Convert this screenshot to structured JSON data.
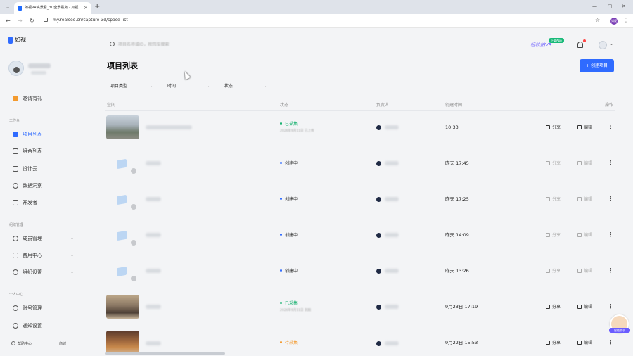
{
  "browser": {
    "tab_title": "如视VR实景看_3D全景看房 - 如视",
    "url": "my.realsee.cn/capture-3d/space-list",
    "profile_initials": "如视"
  },
  "sidebar": {
    "logo": "如视",
    "invite": "邀请有礼",
    "workbench_title": "工作台",
    "items": [
      {
        "label": "项目列表"
      },
      {
        "label": "组合列表"
      },
      {
        "label": "设计云"
      },
      {
        "label": "数据洞察"
      },
      {
        "label": "开发者"
      }
    ],
    "org_title": "组织管理",
    "org_items": [
      {
        "label": "成员管理"
      },
      {
        "label": "费用中心"
      },
      {
        "label": "组织设置"
      }
    ],
    "personal_title": "个人中心",
    "personal_items": [
      {
        "label": "账号管理"
      },
      {
        "label": "通知设置"
      }
    ],
    "footer": {
      "help": "帮助中心",
      "shop": "商城"
    }
  },
  "header": {
    "search_placeholder": "项目名称或ID，按回车搜索",
    "vr_promo": "轻松拍VR",
    "vr_badge": "下载App"
  },
  "main": {
    "title": "项目列表",
    "create_button": "+ 创建项目",
    "filters": [
      "项目类型",
      "时间",
      "状态"
    ],
    "columns": {
      "space": "空间",
      "status": "状态",
      "owner": "负责人",
      "created": "创建时间",
      "ops": "操作"
    },
    "rows": [
      {
        "status": "已采集",
        "status_sub": "2026年9月11日 已上传",
        "created": "10:33",
        "share": "分享",
        "edit": "编辑"
      },
      {
        "status": "创建中",
        "created": "昨天 17:45",
        "share": "分享",
        "edit": "编辑"
      },
      {
        "status": "创建中",
        "created": "昨天 17:25",
        "share": "分享",
        "edit": "编辑"
      },
      {
        "status": "创建中",
        "created": "昨天 14:09",
        "share": "分享",
        "edit": "编辑"
      },
      {
        "status": "创建中",
        "created": "昨天 13:26",
        "share": "分享",
        "edit": "编辑"
      },
      {
        "status": "已采集",
        "status_sub": "2026年9月11日 到期",
        "created": "9月23日 17:19",
        "share": "分享",
        "edit": "编辑"
      },
      {
        "status": "待采集",
        "created": "9月22日 15:53",
        "share": "分享",
        "edit": "编辑"
      }
    ]
  },
  "assistant_label": "智能助手",
  "colors": {
    "accent": "#2f6bff",
    "green": "#16b16f",
    "orange": "#f39a2e"
  }
}
